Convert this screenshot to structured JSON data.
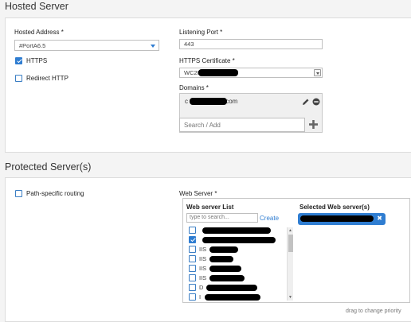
{
  "hosted": {
    "title": "Hosted Server",
    "hosted_address_label": "Hosted Address *",
    "hosted_address_value": "#PortA6.5",
    "https_label": "HTTPS",
    "https_checked": true,
    "redirect_label": "Redirect HTTP",
    "redirect_checked": false,
    "listening_port_label": "Listening Port *",
    "listening_port_value": "443",
    "cert_label": "HTTPS Certificate *",
    "cert_value": "WC20",
    "domains_label": "Domains *",
    "domain_prefix": "c",
    "domain_suffix": ".com",
    "domain_search_placeholder": "Search / Add"
  },
  "protected": {
    "title": "Protected Server(s)",
    "path_routing_label": "Path-specific routing",
    "path_routing_checked": false,
    "web_server_label": "Web Server *",
    "list_title": "Web server List",
    "search_placeholder": "type to search...",
    "create_label": "Create",
    "items": [
      {
        "prefix": "",
        "checked": false
      },
      {
        "prefix": "",
        "checked": true
      },
      {
        "prefix": "IIS",
        "checked": false
      },
      {
        "prefix": "IIS",
        "checked": false
      },
      {
        "prefix": "IIS",
        "checked": false
      },
      {
        "prefix": "IIS",
        "checked": false
      },
      {
        "prefix": "D",
        "checked": false
      },
      {
        "prefix": "I",
        "checked": false
      }
    ],
    "selected_title": "Selected Web server(s)",
    "remove_glyph": "✖",
    "drag_hint": "drag to change priority"
  },
  "colors": {
    "accent": "#2f7dd1",
    "background": "#f4f4f4"
  },
  "icons": {
    "edit": "pencil-icon",
    "remove": "minus-circle-icon",
    "add": "plus-icon"
  }
}
